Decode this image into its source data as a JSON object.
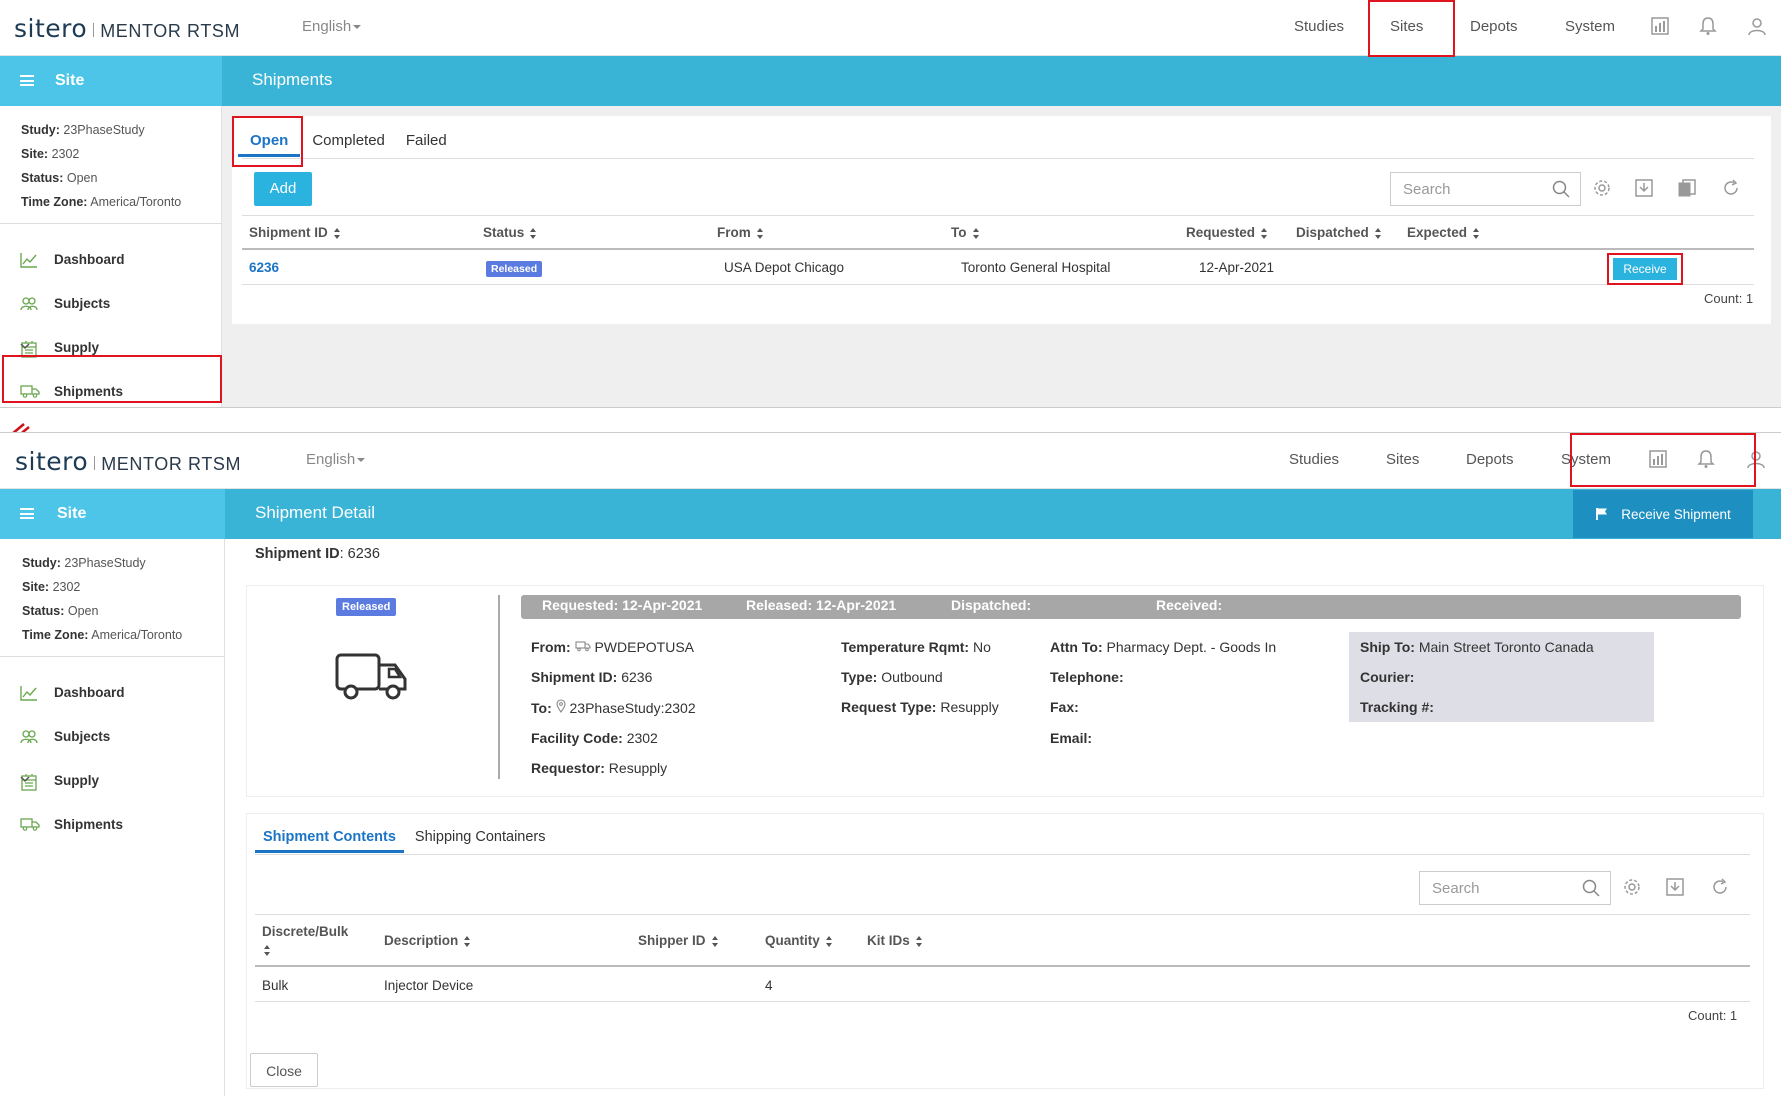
{
  "app": {
    "brand": "sitero",
    "product": "MENTOR RTSM",
    "language": "English",
    "nav": [
      "Studies",
      "Sites",
      "Depots",
      "System"
    ],
    "nav_icons": [
      "report-icon",
      "bell-icon",
      "user-icon"
    ]
  },
  "sidebar": {
    "header": "Site",
    "info": {
      "study_label": "Study:",
      "study": "23PhaseStudy",
      "site_label": "Site:",
      "site": "2302",
      "status_label": "Status:",
      "status": "Open",
      "tz_label": "Time Zone:",
      "tz": "America/Toronto"
    },
    "items": [
      "Dashboard",
      "Subjects",
      "Supply",
      "Shipments"
    ]
  },
  "shipments_page": {
    "title": "Shipments",
    "tabs": [
      "Open",
      "Completed",
      "Failed"
    ],
    "add_label": "Add",
    "search_placeholder": "Search",
    "columns": [
      "Shipment ID",
      "Status",
      "From",
      "To",
      "Requested",
      "Dispatched",
      "Expected"
    ],
    "rows": [
      {
        "id": "6236",
        "status": "Released",
        "from": "USA Depot Chicago",
        "to": "Toronto General Hospital",
        "requested": "12-Apr-2021",
        "dispatched": "",
        "expected": "",
        "action": "Receive"
      }
    ],
    "count": "Count: 1"
  },
  "detail_page": {
    "title": "Shipment Detail",
    "receive_label": "Receive Shipment",
    "shipment_id_label": "Shipment ID",
    "shipment_id": ": 6236",
    "status_badge": "Released",
    "timeline": {
      "requested": "Requested: 12-Apr-2021",
      "released": "Released: 12-Apr-2021",
      "dispatched": "Dispatched:",
      "received": "Received:"
    },
    "col1": [
      {
        "label": "From:",
        "value": "PWDEPOTUSA"
      },
      {
        "label": "Shipment ID:",
        "value": "6236"
      },
      {
        "label": "To:",
        "value": "23PhaseStudy:2302"
      },
      {
        "label": "Facility Code:",
        "value": "2302"
      },
      {
        "label": "Requestor:",
        "value": "Resupply"
      }
    ],
    "col2": [
      {
        "label": "Temperature Rqmt:",
        "value": "No"
      },
      {
        "label": "Type:",
        "value": "Outbound"
      },
      {
        "label": "Request Type:",
        "value": "Resupply"
      }
    ],
    "col3": [
      {
        "label": "Attn To:",
        "value": "Pharmacy Dept. - Goods In"
      },
      {
        "label": "Telephone:",
        "value": ""
      },
      {
        "label": "Fax:",
        "value": ""
      },
      {
        "label": "Email:",
        "value": ""
      }
    ],
    "col4": [
      {
        "label": "Ship To:",
        "value": "Main Street Toronto Canada"
      },
      {
        "label": "Courier:",
        "value": ""
      },
      {
        "label": "Tracking #:",
        "value": ""
      }
    ],
    "tabs": [
      "Shipment Contents",
      "Shipping Containers"
    ],
    "search_placeholder": "Search",
    "columns": [
      "Discrete/Bulk",
      "Description",
      "Shipper ID",
      "Quantity",
      "Kit IDs"
    ],
    "rows": [
      {
        "type": "Bulk",
        "description": "Injector Device",
        "shipper_id": "",
        "quantity": "4",
        "kit_ids": ""
      }
    ],
    "count": "Count: 1",
    "close_label": "Close"
  }
}
